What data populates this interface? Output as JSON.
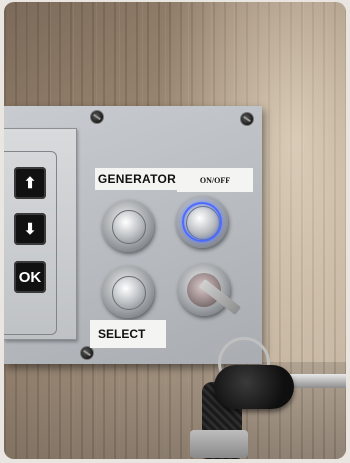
{
  "scene": {
    "labels": {
      "generator": "GENERATOR",
      "on_off": "ON/OFF",
      "select": "SELECT"
    },
    "keypad": {
      "up_glyph": "⬆",
      "down_glyph": "⬇",
      "ok_label": "OK"
    },
    "colors": {
      "panel": "#b9bdc2",
      "led_ring": "#4d6cff",
      "wood": "#9a8671"
    },
    "indicator": {
      "on_off_led_lit": true
    }
  }
}
